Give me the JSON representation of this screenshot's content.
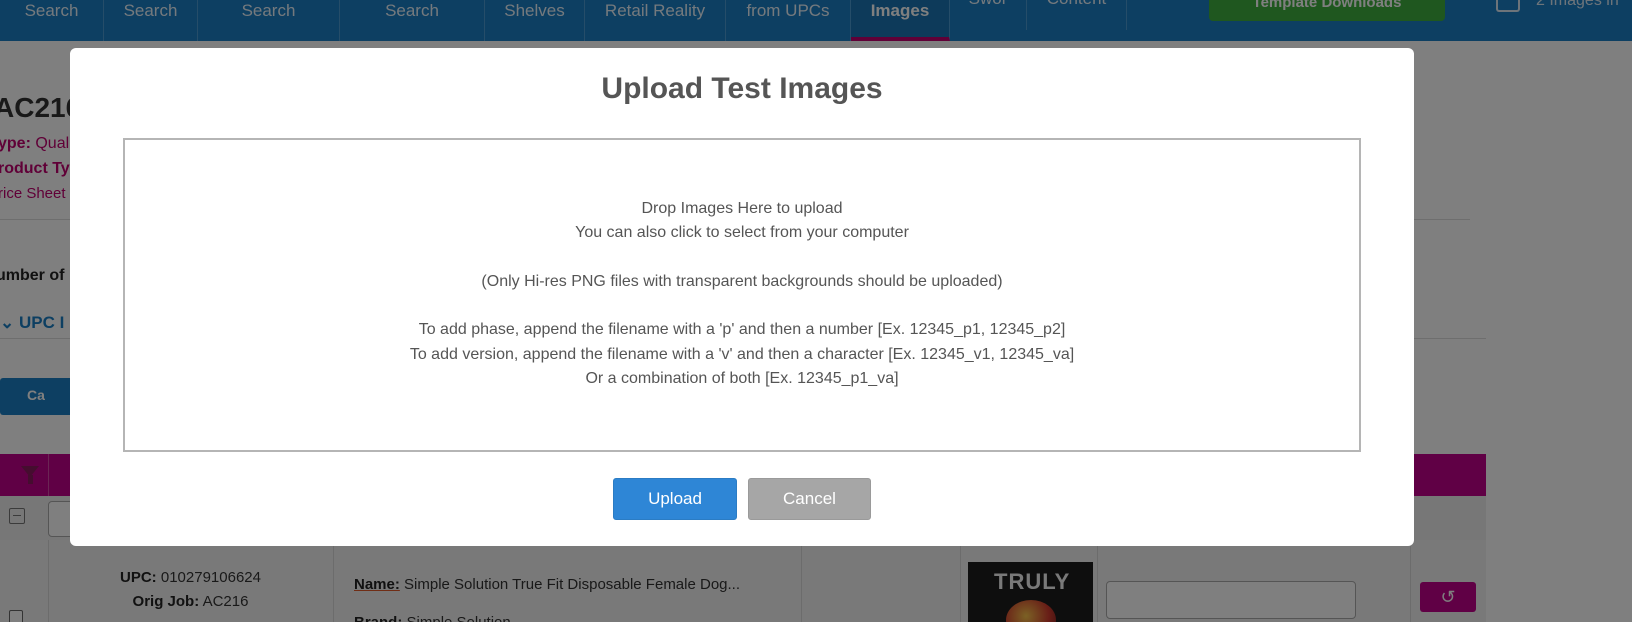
{
  "nav": {
    "items": [
      "Search",
      "Search",
      "Search",
      "Search",
      "Shelves",
      "Retail Reality",
      "from UPCs",
      "Images",
      "Swor",
      "Content"
    ],
    "active_index": 7,
    "template_button": "Template Downloads",
    "cart_text": "2 Images in"
  },
  "page": {
    "job_title": "AC216",
    "type_label": "ype:",
    "type_value": "Quali",
    "product_type_label": "roduct Ty",
    "spec_sheet": "rice Sheet",
    "number_of_label": "umber of",
    "upc_toggle": "UPC I",
    "cart_button": "Ca"
  },
  "table": {
    "row": {
      "upc_label": "UPC:",
      "upc_value": "010279106624",
      "orig_job_label": "Orig Job:",
      "orig_job_value": "AC216",
      "name_label": "Name:",
      "name_value": "Simple Solution True Fit Disposable Female Dog...",
      "brand_label": "Brand:",
      "brand_value": "Simple Solution",
      "thumb_text": "TRULY"
    },
    "reset_icon": "↺"
  },
  "modal": {
    "title": "Upload Test Images",
    "dropzone": {
      "line1": "Drop Images Here to upload",
      "line2": "You can also click to select from your computer",
      "line3": "(Only Hi-res PNG files with transparent backgrounds should be uploaded)",
      "line4": "To add phase, append the filename with a 'p' and then a number [Ex. 12345_p1, 12345_p2]",
      "line5": "To add version, append the filename with a 'v' and then a character [Ex. 12345_v1, 12345_va]",
      "line6": "Or a combination of both [Ex. 12345_p1_va]"
    },
    "upload_label": "Upload",
    "cancel_label": "Cancel"
  },
  "colors": {
    "nav_blue": "#1b7fc4",
    "accent_magenta": "#c1008a",
    "upload_blue": "#2e86d6",
    "cancel_grey": "#a6a6a6"
  }
}
